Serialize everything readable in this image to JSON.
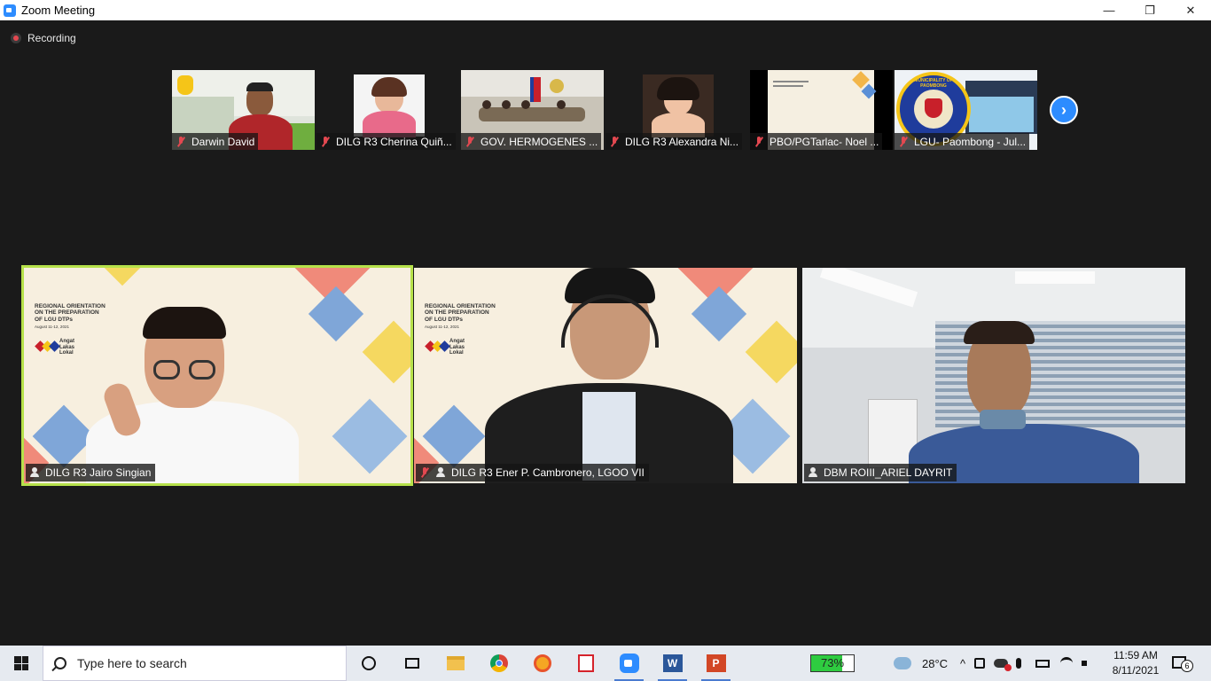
{
  "window": {
    "title": "Zoom Meeting",
    "minimize": "—",
    "restore": "❐",
    "close": "✕"
  },
  "recording": {
    "label": "Recording"
  },
  "thumbnails": [
    {
      "name": "Darwin David",
      "hand_raised": true
    },
    {
      "name": "DILG R3 Cherina Quiñ..."
    },
    {
      "name": "GOV. HERMOGENES ..."
    },
    {
      "name": "DILG R3 Alexandra Ni..."
    },
    {
      "name": "PBO/PGTarlac- Noel ..."
    },
    {
      "name": "LGU- Paombong - Jul..."
    }
  ],
  "seal_text": "MUNICIPALITY OF PAOMBONG",
  "slide": {
    "line1": "REGIONAL ORIENTATION",
    "line2": "ON THE PREPARATION",
    "line3": "OF LGU DTPs",
    "date": "August 11-12, 2021",
    "brand1": "Angat",
    "brand2": "Lakas",
    "brand3": "Lokal"
  },
  "tiles": [
    {
      "name": "DILG R3 Jairo Singian"
    },
    {
      "name": "DILG R3 Ener P. Cambronero, LGOO VII"
    },
    {
      "name": "DBM ROIII_ARIEL DAYRIT"
    }
  ],
  "taskbar": {
    "search_placeholder": "Type here to search",
    "battery_percent": 73,
    "battery_label": "73%",
    "weather": "28°C",
    "time": "11:59 AM",
    "date": "8/11/2021",
    "notification_count": "6"
  },
  "colors": {
    "zoom_blue": "#2d8cff",
    "muted_red": "#e34850",
    "active_speaker": "#b6e14a"
  }
}
